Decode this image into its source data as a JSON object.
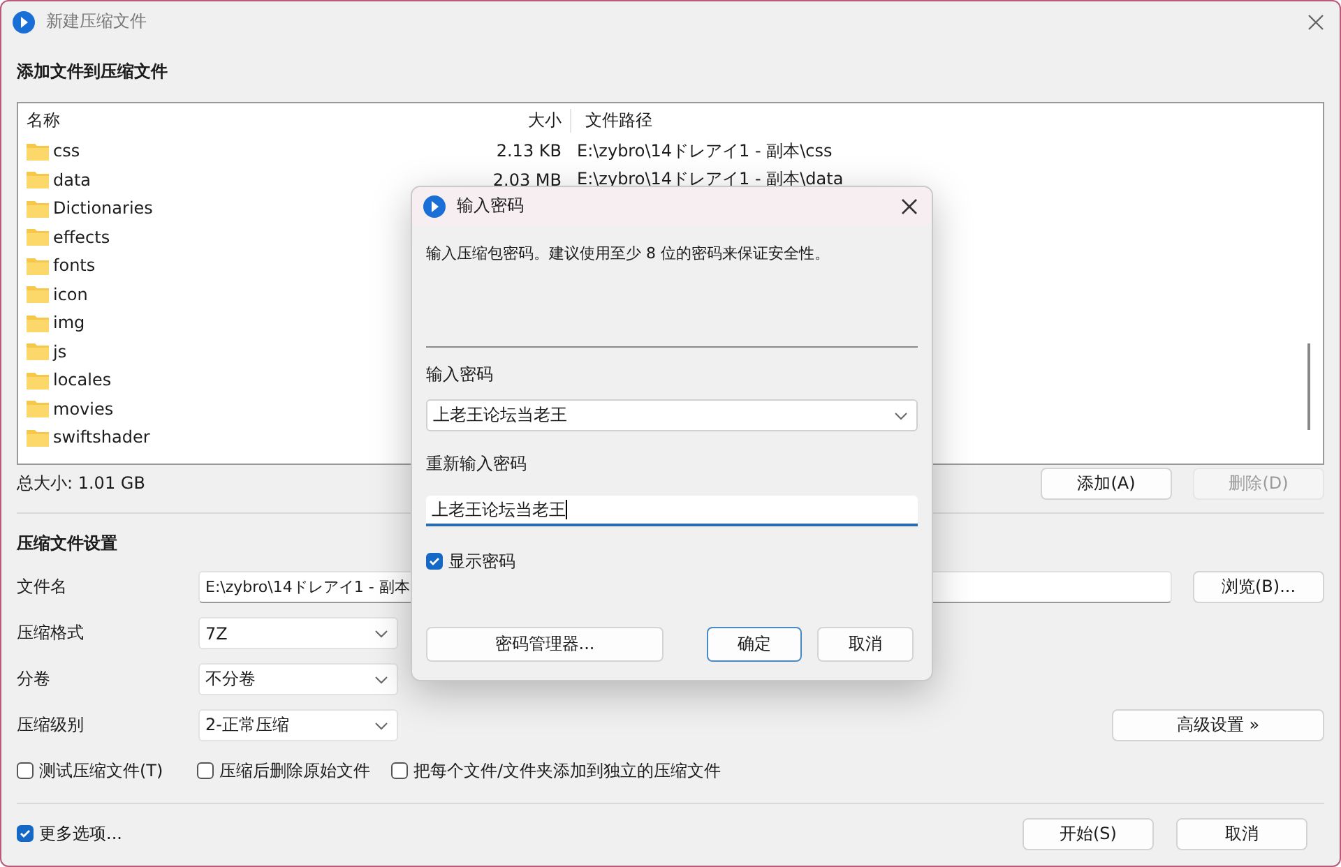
{
  "window": {
    "title": "新建压缩文件"
  },
  "file_section": {
    "title": "添加文件到压缩文件",
    "columns": [
      "名称",
      "大小",
      "文件路径"
    ],
    "rows": [
      {
        "name": "css",
        "size": "2.13 KB",
        "path": "E:\\zybro\\14ドレアイ1 - 副本\\css"
      },
      {
        "name": "data",
        "size": "2.03 MB",
        "path": "E:\\zybro\\14ドレアイ1 - 副本\\data"
      },
      {
        "name": "Dictionaries"
      },
      {
        "name": "effects"
      },
      {
        "name": "fonts"
      },
      {
        "name": "icon"
      },
      {
        "name": "img"
      },
      {
        "name": "js"
      },
      {
        "name": "locales"
      },
      {
        "name": "movies"
      },
      {
        "name": "swiftshader"
      }
    ],
    "total": "总大小: 1.01 GB",
    "buttons": [
      {
        "label": "添加(A)",
        "disabled": false
      },
      {
        "label": "删除(D)",
        "disabled": true
      }
    ]
  },
  "settings": {
    "title": "压缩文件设置",
    "fields": [
      {
        "kind": "input",
        "label": "文件名",
        "value": "E:\\zybro\\14ドレアイ1 - 副本"
      },
      {
        "kind": "select",
        "label": "压缩格式",
        "value": "7Z"
      },
      {
        "kind": "select",
        "label": "分卷",
        "value": "不分卷"
      },
      {
        "kind": "select",
        "label": "压缩级别",
        "value": "2-正常压缩"
      }
    ],
    "browse_button": "浏览(B)...",
    "advanced_button": "高级设置 »",
    "options": [
      {
        "label": "测试压缩文件(T)",
        "checked": false
      },
      {
        "label": "压缩后删除原始文件",
        "checked": false
      },
      {
        "label": "把每个文件/文件夹添加到独立的压缩文件",
        "checked": false
      }
    ]
  },
  "more_options": {
    "label": "更多选项...",
    "checked": true
  },
  "buttons": [
    "开始(S)",
    "取消"
  ],
  "dialog": {
    "title": "输入密码",
    "description": "输入压缩包密码。建议使用至少 8 位的密码来保证安全性。",
    "password_label": "输入密码",
    "password": "上老王论坛当老王",
    "repeat_label": "重新输入密码",
    "repeat": "上老王论坛当老王",
    "show_password": {
      "label": "显示密码",
      "checked": true
    },
    "buttons": [
      {
        "label": "密码管理器...",
        "kind": "normal"
      },
      {
        "label": "确定",
        "kind": "default"
      },
      {
        "label": "取消",
        "kind": "normal"
      }
    ]
  }
}
